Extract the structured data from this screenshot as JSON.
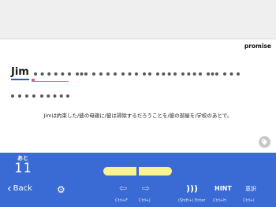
{
  "header": {
    "keyword": "promise"
  },
  "sentence": {
    "first_word": "Jim",
    "row1_blanks": [
      9,
      3,
      6,
      4,
      2,
      5,
      5,
      3,
      4
    ],
    "row2_blanks": [
      6,
      7
    ]
  },
  "translation": "Jimは約束した/彼の母親に/彼は掃除するだろうことを/彼の部屋を/学校のあとで。",
  "panel": {
    "remaining_label": "あと",
    "remaining_count": "11",
    "back_label": "Back",
    "hint_label": "HINT",
    "meaning_label": "意訳",
    "shortcuts": {
      "prev": "Ctrl+F",
      "next": "Ctrl+J",
      "sound": "(Shift+) Enter",
      "hint": "Ctrl+H",
      "meaning": "Ctrl+I"
    }
  },
  "colors": {
    "panel_bg": "#3a6ad3",
    "answer_slot": "#fbf38f",
    "underline_blue": "#2b57d6",
    "cursor_pink": "#e05a8c"
  }
}
